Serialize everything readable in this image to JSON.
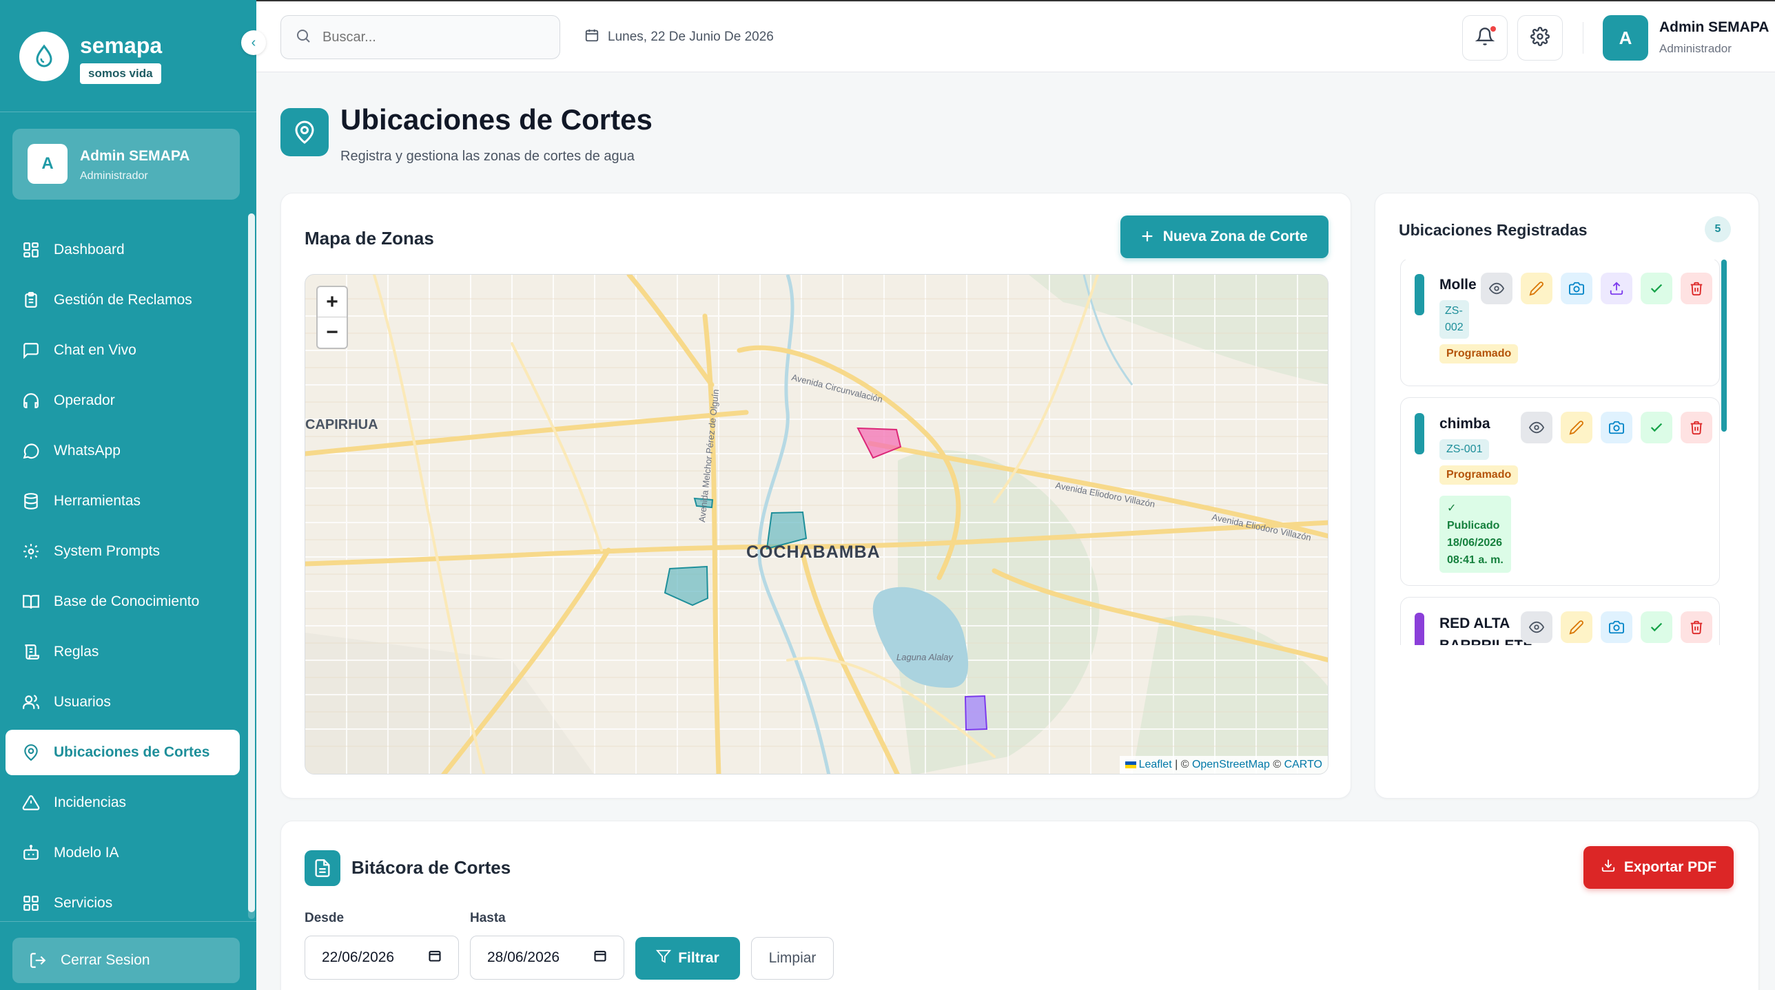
{
  "brand": {
    "name": "semapa",
    "tagline": "somos vida"
  },
  "sidebar": {
    "user": {
      "initial": "A",
      "name": "Admin SEMAPA",
      "role": "Administrador"
    },
    "items": [
      {
        "label": "Dashboard",
        "icon": "dashboard-icon"
      },
      {
        "label": "Gestión de Reclamos",
        "icon": "clipboard-icon"
      },
      {
        "label": "Chat en Vivo",
        "icon": "chat-icon"
      },
      {
        "label": "Operador",
        "icon": "headset-icon"
      },
      {
        "label": "WhatsApp",
        "icon": "whatsapp-icon"
      },
      {
        "label": "Herramientas",
        "icon": "database-icon"
      },
      {
        "label": "System Prompts",
        "icon": "gear-icon"
      },
      {
        "label": "Base de Conocimiento",
        "icon": "book-icon"
      },
      {
        "label": "Reglas",
        "icon": "scroll-icon"
      },
      {
        "label": "Usuarios",
        "icon": "users-icon"
      },
      {
        "label": "Ubicaciones de Cortes",
        "icon": "map-pin-icon",
        "active": true
      },
      {
        "label": "Incidencias",
        "icon": "warning-icon"
      },
      {
        "label": "Modelo IA",
        "icon": "bot-icon"
      },
      {
        "label": "Servicios",
        "icon": "grid-icon"
      }
    ],
    "logout_label": "Cerrar Sesion"
  },
  "topbar": {
    "search_placeholder": "Buscar...",
    "date": "Lunes, 22 De Junio De 2026",
    "user": {
      "initial": "A",
      "name": "Admin SEMAPA",
      "role": "Administrador"
    }
  },
  "page": {
    "title": "Ubicaciones de Cortes",
    "subtitle": "Registra y gestiona las zonas de cortes de agua"
  },
  "map_card": {
    "title": "Mapa de Zonas",
    "new_zone_label": "Nueva Zona de Corte",
    "zoom_in": "+",
    "zoom_out": "−",
    "labels": {
      "city": "COCHABAMBA",
      "district": "CAPIRHUA",
      "road1": "Avenida Circunvalación",
      "road2": "Avenida Eliodoro Villazón",
      "road3": "Avenida Eliodoro Villazón",
      "road4": "Avenida Melchor Pérez de Olguín",
      "lake": "Laguna Alalay"
    },
    "attribution": {
      "leaflet": "Leaflet",
      "sep1": " | © ",
      "osm": "OpenStreetMap",
      "sep2": " © ",
      "carto": "CARTO"
    }
  },
  "list_card": {
    "title": "Ubicaciones Registradas",
    "count": "5",
    "zones": [
      {
        "name": "Molle",
        "code_line1": "ZS-",
        "code_line2": "002",
        "status": "Programado",
        "color": "#1e9aa6"
      },
      {
        "name": "chimba",
        "code": "ZS-001",
        "status": "Programado",
        "published_label": "Publicado",
        "published_date": "18/06/2026",
        "published_time": "08:41 a. m.",
        "color": "#1e9aa6"
      },
      {
        "name_line1": "RED ALTA",
        "name_line2": "BARRRILETE",
        "color": "#8b3fd9"
      }
    ]
  },
  "bitacora": {
    "title": "Bitácora de Cortes",
    "export_label": "Exportar PDF",
    "from_label": "Desde",
    "from_value": "22/06/2026",
    "to_label": "Hasta",
    "to_value": "28/06/2026",
    "filter_label": "Filtrar",
    "clear_label": "Limpiar"
  },
  "colors": {
    "primary": "#1e9aa6",
    "danger": "#dc2626",
    "warning": "#b45309"
  }
}
